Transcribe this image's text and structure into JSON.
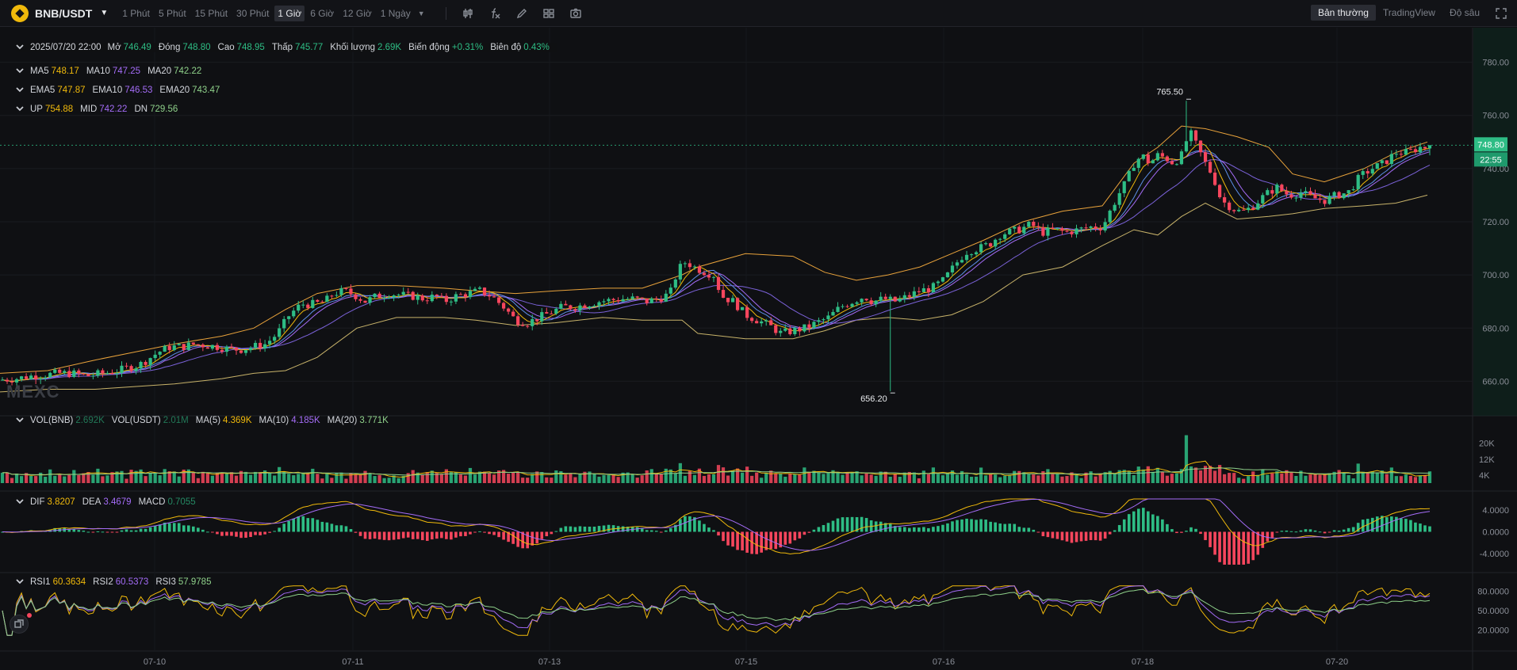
{
  "symbol": {
    "name": "BNB/USDT"
  },
  "intervals": [
    "1 Phút",
    "5 Phút",
    "15 Phút",
    "30 Phút",
    "1 Giờ",
    "6 Giờ",
    "12 Giờ",
    "1 Ngày"
  ],
  "active_interval": "1 Giờ",
  "tools": [
    "candle-type-icon",
    "indicator-fx-icon",
    "draw-pen-icon",
    "layout-grid-icon",
    "camera-icon"
  ],
  "views": [
    "Bản thường",
    "TradingView",
    "Độ sâu"
  ],
  "active_view": "Bản thường",
  "ohlc": {
    "date": "2025/07/20 22:00",
    "open_label": "Mở",
    "open": "746.49",
    "close_label": "Đóng",
    "close": "748.80",
    "high_label": "Cao",
    "high": "748.95",
    "low_label": "Thấp",
    "low": "745.77",
    "volume_label": "Khối lượng",
    "volume": "2.69K",
    "change_label": "Biến động",
    "change": "+0.31%",
    "amplitude_label": "Biên độ",
    "amplitude": "0.43%"
  },
  "ma": {
    "ma5_label": "MA5",
    "ma5": "748.17",
    "ma10_label": "MA10",
    "ma10": "747.25",
    "ma20_label": "MA20",
    "ma20": "742.22"
  },
  "ema": {
    "ema5_label": "EMA5",
    "ema5": "747.87",
    "ema10_label": "EMA10",
    "ema10": "746.53",
    "ema20_label": "EMA20",
    "ema20": "743.47"
  },
  "boll": {
    "up_label": "UP",
    "up": "754.88",
    "mid_label": "MID",
    "mid": "742.22",
    "dn_label": "DN",
    "dn": "729.56"
  },
  "vol": {
    "bnb_label": "VOL(BNB)",
    "bnb": "2.692K",
    "usdt_label": "VOL(USDT)",
    "usdt": "2.01M",
    "ma5_label": "MA(5)",
    "ma5": "4.369K",
    "ma10_label": "MA(10)",
    "ma10": "4.185K",
    "ma20_label": "MA(20)",
    "ma20": "3.771K"
  },
  "macd": {
    "dif_label": "DIF",
    "dif": "3.8207",
    "dea_label": "DEA",
    "dea": "3.4679",
    "macd_label": "MACD",
    "macd": "0.7055"
  },
  "rsi": {
    "rsi1_label": "RSI1",
    "rsi1": "60.3634",
    "rsi2_label": "RSI2",
    "rsi2": "60.5373",
    "rsi3_label": "RSI3",
    "rsi3": "57.9785"
  },
  "watermark": "MEXC",
  "colors": {
    "up": "#2ebd85",
    "down": "#f6465d",
    "ma5": "#f0b90b",
    "ma10": "#a46cf7",
    "ma20": "#b07cff",
    "boll": "#e8a23b",
    "background": "#0f1013"
  },
  "chart_data": {
    "type": "candlestick",
    "price_axis": {
      "min": 650,
      "max": 790,
      "ticks": [
        "780.00",
        "760.00",
        "740.00",
        "720.00",
        "700.00",
        "680.00",
        "660.00"
      ]
    },
    "current_price": "748.80",
    "countdown": "22:55",
    "max_marker": "765.50",
    "min_marker": "656.20",
    "x_ticks": [
      "07-10",
      "07-11",
      "07-13",
      "07-15",
      "07-16",
      "07-18",
      "07-20"
    ],
    "price_path": [
      [
        0,
        660.5
      ],
      [
        20,
        661
      ],
      [
        40,
        662
      ],
      [
        60,
        662.5
      ],
      [
        75,
        663
      ],
      [
        90,
        663
      ],
      [
        110,
        662
      ],
      [
        130,
        663
      ],
      [
        150,
        664
      ],
      [
        160,
        665
      ],
      [
        175,
        666
      ],
      [
        190,
        669
      ],
      [
        200,
        671
      ],
      [
        215,
        673
      ],
      [
        230,
        673
      ],
      [
        245,
        674
      ],
      [
        260,
        673.5
      ],
      [
        275,
        673
      ],
      [
        290,
        672
      ],
      [
        305,
        672
      ],
      [
        320,
        673
      ],
      [
        335,
        674
      ],
      [
        350,
        678
      ],
      [
        365,
        685
      ],
      [
        380,
        689
      ],
      [
        395,
        689
      ],
      [
        410,
        690
      ],
      [
        420,
        693
      ],
      [
        435,
        694
      ],
      [
        450,
        692
      ],
      [
        460,
        690
      ],
      [
        475,
        692
      ],
      [
        490,
        693
      ],
      [
        505,
        692.5
      ],
      [
        520,
        692
      ],
      [
        535,
        691
      ],
      [
        550,
        692
      ],
      [
        560,
        690
      ],
      [
        575,
        692
      ],
      [
        590,
        693
      ],
      [
        605,
        694
      ],
      [
        620,
        692
      ],
      [
        635,
        688
      ],
      [
        650,
        683
      ],
      [
        665,
        682
      ],
      [
        680,
        684
      ],
      [
        695,
        686
      ],
      [
        710,
        688
      ],
      [
        725,
        688
      ],
      [
        740,
        689
      ],
      [
        755,
        690
      ],
      [
        770,
        690.5
      ],
      [
        785,
        691
      ],
      [
        800,
        691
      ],
      [
        815,
        690
      ],
      [
        830,
        691
      ],
      [
        845,
        693
      ],
      [
        855,
        702
      ],
      [
        865,
        705
      ],
      [
        875,
        703
      ],
      [
        890,
        701
      ],
      [
        900,
        700
      ],
      [
        910,
        692
      ],
      [
        925,
        690
      ],
      [
        940,
        685
      ],
      [
        955,
        683
      ],
      [
        970,
        681
      ],
      [
        985,
        678
      ],
      [
        1000,
        679
      ],
      [
        1015,
        680
      ],
      [
        1030,
        682
      ],
      [
        1045,
        684
      ],
      [
        1060,
        688
      ],
      [
        1075,
        690
      ],
      [
        1090,
        692
      ],
      [
        1100,
        690
      ],
      [
        1115,
        691
      ],
      [
        1130,
        690
      ],
      [
        1145,
        692
      ],
      [
        1160,
        694
      ],
      [
        1175,
        695
      ],
      [
        1190,
        698
      ],
      [
        1200,
        702
      ],
      [
        1210,
        706
      ],
      [
        1220,
        709
      ],
      [
        1235,
        710
      ],
      [
        1250,
        712
      ],
      [
        1260,
        715
      ],
      [
        1270,
        716
      ],
      [
        1285,
        717
      ],
      [
        1300,
        719
      ],
      [
        1315,
        716
      ],
      [
        1330,
        717
      ],
      [
        1345,
        716
      ],
      [
        1360,
        717
      ],
      [
        1375,
        718
      ],
      [
        1390,
        718
      ],
      [
        1400,
        724
      ],
      [
        1410,
        730
      ],
      [
        1420,
        735
      ],
      [
        1430,
        742
      ],
      [
        1440,
        745
      ],
      [
        1450,
        742
      ],
      [
        1460,
        745
      ],
      [
        1470,
        744
      ],
      [
        1480,
        742
      ],
      [
        1490,
        745
      ],
      [
        1500,
        754
      ],
      [
        1510,
        748
      ],
      [
        1520,
        742
      ],
      [
        1530,
        737
      ],
      [
        1540,
        728
      ],
      [
        1550,
        726
      ],
      [
        1560,
        724
      ],
      [
        1570,
        724
      ],
      [
        1580,
        726
      ],
      [
        1595,
        730
      ],
      [
        1610,
        733
      ],
      [
        1625,
        730
      ],
      [
        1640,
        731
      ],
      [
        1655,
        729
      ],
      [
        1670,
        728
      ],
      [
        1685,
        730
      ],
      [
        1700,
        731
      ],
      [
        1715,
        737
      ],
      [
        1730,
        740
      ],
      [
        1745,
        742
      ],
      [
        1760,
        746
      ],
      [
        1775,
        746
      ],
      [
        1790,
        748
      ],
      [
        1800,
        748
      ]
    ],
    "boll_up_path": [
      [
        0,
        663
      ],
      [
        60,
        664
      ],
      [
        120,
        668
      ],
      [
        170,
        671
      ],
      [
        220,
        674
      ],
      [
        280,
        677
      ],
      [
        320,
        680
      ],
      [
        360,
        687
      ],
      [
        400,
        693
      ],
      [
        450,
        696
      ],
      [
        500,
        696
      ],
      [
        560,
        695
      ],
      [
        600,
        694
      ],
      [
        650,
        693
      ],
      [
        700,
        694
      ],
      [
        760,
        695
      ],
      [
        810,
        695
      ],
      [
        860,
        700
      ],
      [
        880,
        703
      ],
      [
        940,
        708
      ],
      [
        1000,
        707
      ],
      [
        1040,
        701
      ],
      [
        1080,
        698
      ],
      [
        1120,
        700
      ],
      [
        1160,
        703
      ],
      [
        1200,
        708
      ],
      [
        1240,
        713
      ],
      [
        1290,
        720
      ],
      [
        1340,
        724
      ],
      [
        1390,
        726
      ],
      [
        1430,
        742
      ],
      [
        1460,
        748
      ],
      [
        1490,
        756
      ],
      [
        1520,
        755
      ],
      [
        1560,
        752
      ],
      [
        1600,
        748
      ],
      [
        1630,
        738
      ],
      [
        1670,
        735
      ],
      [
        1720,
        740
      ],
      [
        1760,
        746
      ],
      [
        1800,
        750
      ]
    ],
    "boll_dn_path": [
      [
        0,
        656
      ],
      [
        60,
        657
      ],
      [
        120,
        657
      ],
      [
        170,
        658
      ],
      [
        220,
        659
      ],
      [
        280,
        661
      ],
      [
        320,
        663
      ],
      [
        360,
        664
      ],
      [
        400,
        669
      ],
      [
        450,
        680
      ],
      [
        500,
        684
      ],
      [
        560,
        684
      ],
      [
        600,
        683
      ],
      [
        650,
        681
      ],
      [
        700,
        682
      ],
      [
        760,
        684
      ],
      [
        810,
        683
      ],
      [
        860,
        683
      ],
      [
        880,
        678
      ],
      [
        940,
        676
      ],
      [
        1000,
        676
      ],
      [
        1040,
        679
      ],
      [
        1080,
        683
      ],
      [
        1120,
        684
      ],
      [
        1160,
        683
      ],
      [
        1200,
        685
      ],
      [
        1240,
        690
      ],
      [
        1290,
        700
      ],
      [
        1340,
        703
      ],
      [
        1390,
        711
      ],
      [
        1430,
        717
      ],
      [
        1460,
        715
      ],
      [
        1490,
        722
      ],
      [
        1520,
        727
      ],
      [
        1560,
        721
      ],
      [
        1600,
        722
      ],
      [
        1630,
        723
      ],
      [
        1670,
        725
      ],
      [
        1720,
        726
      ],
      [
        1760,
        727
      ],
      [
        1800,
        730
      ]
    ],
    "volume_axis": {
      "ticks": [
        "20K",
        "12K",
        "4K"
      ]
    },
    "macd_axis": {
      "ticks": [
        "4.0000",
        "0.0000",
        "-4.0000"
      ]
    },
    "rsi_axis": {
      "ticks": [
        "80.0000",
        "50.0000",
        "20.0000"
      ]
    }
  }
}
